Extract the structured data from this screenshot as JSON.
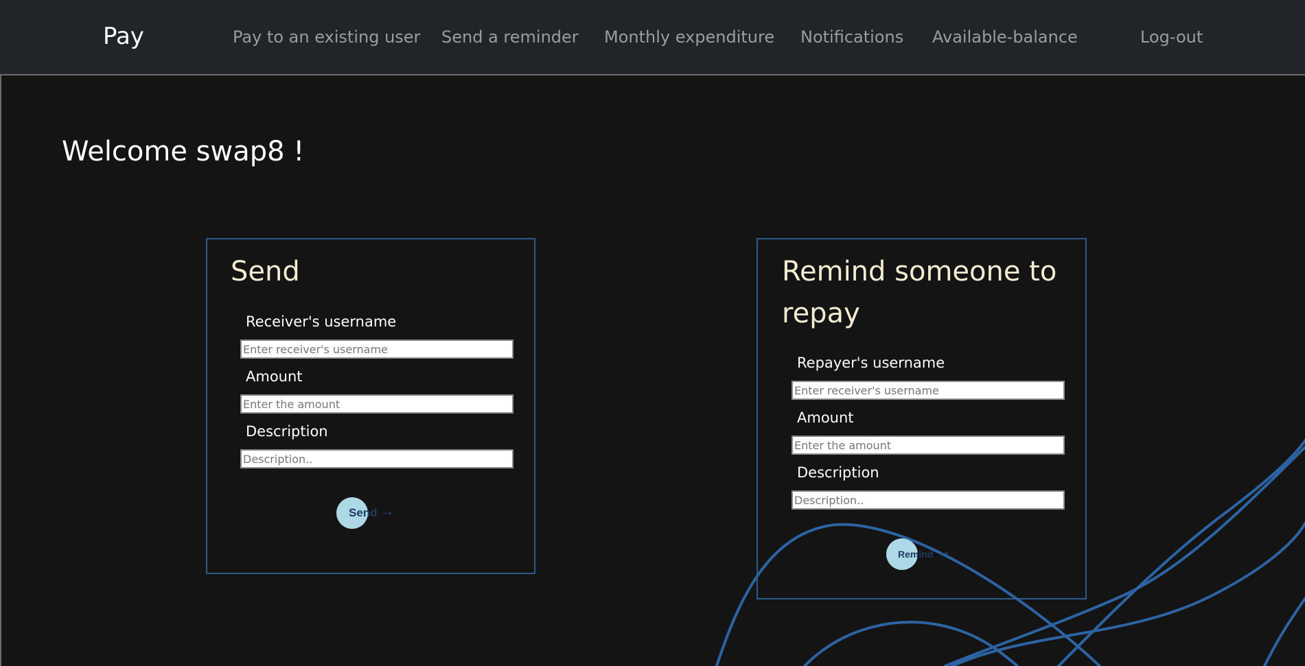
{
  "nav": {
    "brand": "Pay",
    "links": [
      {
        "label": "Pay to an existing user"
      },
      {
        "label": "Send a reminder"
      },
      {
        "label": "Monthly expenditure"
      },
      {
        "label": "Notifications"
      },
      {
        "label": "Available-balance"
      }
    ],
    "logout": "Log-out"
  },
  "main": {
    "welcome": "Welcome swap8 !"
  },
  "send_card": {
    "title": "Send",
    "receiver_label": "Receiver's username",
    "receiver_placeholder": "Enter receiver's username",
    "amount_label": "Amount",
    "amount_placeholder": "Enter the amount",
    "description_label": "Description",
    "description_placeholder": "Description..",
    "button_label": "Send",
    "button_arrow": "→"
  },
  "remind_card": {
    "title": "Remind someone to repay",
    "repayer_label": "Repayer's username",
    "repayer_placeholder": "Enter receiver's username",
    "amount_label": "Amount",
    "amount_placeholder": "Enter the amount",
    "description_label": "Description",
    "description_placeholder": "Description..",
    "button_label": "Remind",
    "button_arrow": "→"
  },
  "colors": {
    "background": "#141414",
    "navbar": "#212529",
    "card_border": "#2d5b8e",
    "button": "#add8e6",
    "decor_lines": "#2f6db3"
  }
}
